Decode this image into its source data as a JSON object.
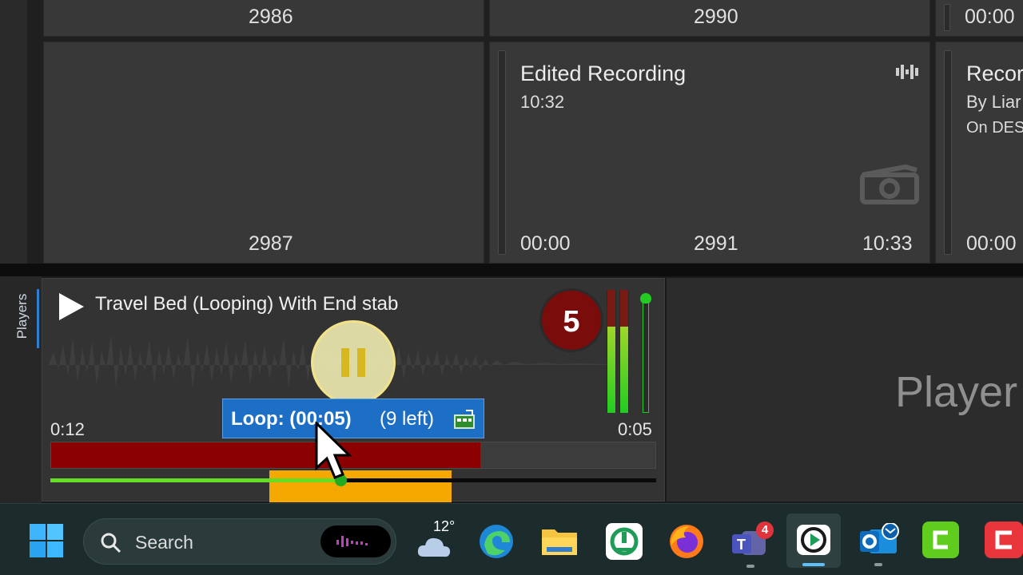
{
  "cart_tiles": {
    "t2986": "2986",
    "t2990": "2990",
    "t_top_right_time": "00:00",
    "t2987": "2987",
    "edited": {
      "title": "Edited Recording",
      "duration": "10:32",
      "start": "00:00",
      "number": "2991",
      "end": "10:33"
    },
    "partial": {
      "title": "Recor",
      "by": "By Liar",
      "on": "On DES",
      "time": "00:00"
    }
  },
  "players_tab": {
    "label": "Players"
  },
  "player": {
    "title": "Travel Bed (Looping) With End stab",
    "badge_number": "5",
    "elapsed": "0:12",
    "remaining": "0:05",
    "loop_label": "Loop: (00:05)",
    "loop_left": "(9 left)",
    "progress_fraction": 0.71,
    "colors": {
      "progress": "#8b0000",
      "meter": "#22cc22",
      "loop_region": "#f5a800",
      "loop_badge": "#1c6fc4"
    }
  },
  "player2": {
    "label": "Player"
  },
  "taskbar": {
    "search_placeholder": "Search",
    "weather_temp": "12°",
    "teams_badge": "4",
    "icons": [
      "windows-start-icon",
      "search-icon",
      "widget-icon",
      "weather-icon",
      "edge-icon",
      "file-explorer-icon",
      "radio-app-icon",
      "firefox-icon",
      "teams-icon",
      "player-app-icon",
      "outlook-icon",
      "camtasia-icon",
      "red-app-icon"
    ]
  }
}
